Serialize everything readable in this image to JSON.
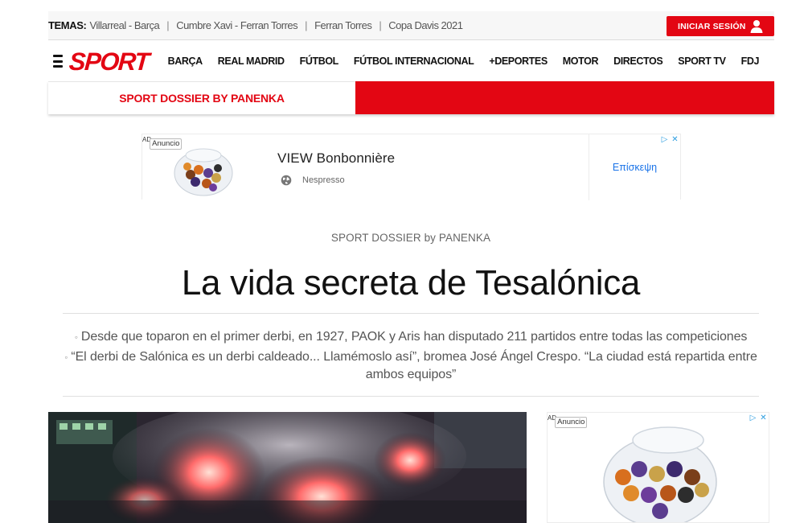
{
  "topbar": {
    "temas_label": "TEMAS:",
    "temas": [
      "Villarreal - Barça",
      "Cumbre Xavi - Ferran Torres",
      "Ferran Torres",
      "Copa Davis 2021"
    ],
    "login_label": "INICIAR SESIÓN"
  },
  "nav": {
    "logo": "SPORT",
    "items": [
      "BARÇA",
      "REAL MADRID",
      "FÚTBOL",
      "FÚTBOL INTERNACIONAL",
      "+DEPORTES",
      "MOTOR",
      "DIRECTOS",
      "SPORT TV",
      "FDJ"
    ]
  },
  "dossier_banner": {
    "label": "SPORT DOSSIER BY PANENKA"
  },
  "ad_top": {
    "ad_label": "AD",
    "tag": "Anuncio",
    "title": "VIEW Bonbonnière",
    "source": "Nespresso",
    "cta": "Επίσκεψη"
  },
  "article": {
    "kicker": "SPORT DOSSIER by PANENKA",
    "headline": "La vida secreta de Tesalónica",
    "summary": [
      "Desde que toparon en el primer derbi, en 1927, PAOK y Aris han disputado 211 partidos entre todas las competiciones",
      "“El derbi de Salónica es un derbi caldeado... Llamémoslo así”, bromea José Ángel Crespo. “La ciudad está repartida entre ambos equipos”"
    ]
  },
  "ad_side": {
    "ad_label": "AD",
    "tag": "Anuncio"
  },
  "colors": {
    "brand_red": "#e30613",
    "link_blue": "#1a73e8"
  }
}
